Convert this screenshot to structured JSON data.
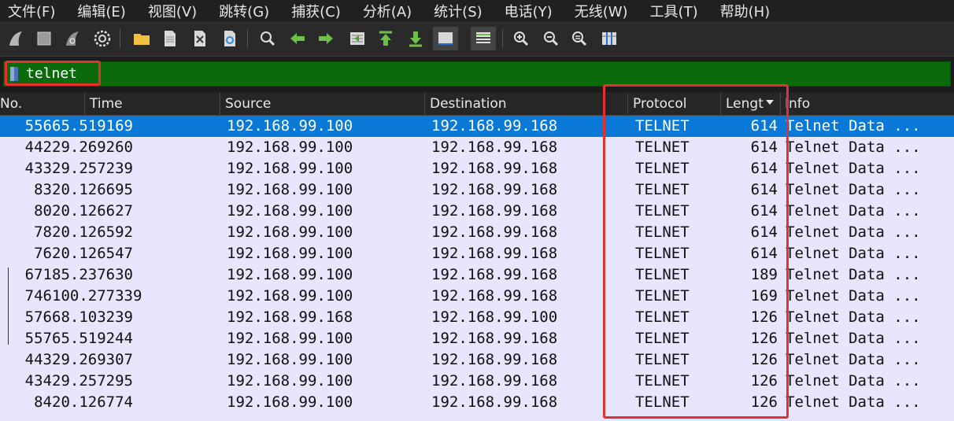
{
  "menu": [
    "文件(F)",
    "编辑(E)",
    "视图(V)",
    "跳转(G)",
    "捕获(C)",
    "分析(A)",
    "统计(S)",
    "电话(Y)",
    "无线(W)",
    "工具(T)",
    "帮助(H)"
  ],
  "toolbar": {
    "icons": [
      "shark-fin-start-icon",
      "stop-icon",
      "shark-fin-restart-icon",
      "options-gear-icon",
      "open-folder-icon",
      "file-icon",
      "close-file-icon",
      "reload-icon",
      "find-icon",
      "back-arrow-icon",
      "forward-arrow-icon",
      "go-to-packet-icon",
      "first-packet-icon",
      "last-packet-icon",
      "autoscroll-icon",
      "colorize-icon",
      "zoom-in-icon",
      "zoom-out-icon",
      "zoom-normal-icon",
      "resize-columns-icon"
    ]
  },
  "filter": {
    "value": "telnet"
  },
  "columns": {
    "no": "No.",
    "time": "Time",
    "source": "Source",
    "destination": "Destination",
    "protocol": "Protocol",
    "length": "Lengt",
    "info": "Info"
  },
  "packets": [
    {
      "no": "556",
      "time": "65.519169",
      "src": "192.168.99.100",
      "dst": "192.168.99.168",
      "proto": "TELNET",
      "len": "614",
      "info": "Telnet Data ..."
    },
    {
      "no": "442",
      "time": "29.269260",
      "src": "192.168.99.100",
      "dst": "192.168.99.168",
      "proto": "TELNET",
      "len": "614",
      "info": "Telnet Data ..."
    },
    {
      "no": "433",
      "time": "29.257239",
      "src": "192.168.99.100",
      "dst": "192.168.99.168",
      "proto": "TELNET",
      "len": "614",
      "info": "Telnet Data ..."
    },
    {
      "no": "83",
      "time": "20.126695",
      "src": "192.168.99.100",
      "dst": "192.168.99.168",
      "proto": "TELNET",
      "len": "614",
      "info": "Telnet Data ..."
    },
    {
      "no": "80",
      "time": "20.126627",
      "src": "192.168.99.100",
      "dst": "192.168.99.168",
      "proto": "TELNET",
      "len": "614",
      "info": "Telnet Data ..."
    },
    {
      "no": "78",
      "time": "20.126592",
      "src": "192.168.99.100",
      "dst": "192.168.99.168",
      "proto": "TELNET",
      "len": "614",
      "info": "Telnet Data ..."
    },
    {
      "no": "76",
      "time": "20.126547",
      "src": "192.168.99.100",
      "dst": "192.168.99.168",
      "proto": "TELNET",
      "len": "614",
      "info": "Telnet Data ..."
    },
    {
      "no": "671",
      "time": "85.237630",
      "src": "192.168.99.100",
      "dst": "192.168.99.168",
      "proto": "TELNET",
      "len": "189",
      "info": "Telnet Data ..."
    },
    {
      "no": "746",
      "time": "100.277339",
      "src": "192.168.99.100",
      "dst": "192.168.99.168",
      "proto": "TELNET",
      "len": "169",
      "info": "Telnet Data ..."
    },
    {
      "no": "576",
      "time": "68.103239",
      "src": "192.168.99.168",
      "dst": "192.168.99.100",
      "proto": "TELNET",
      "len": "126",
      "info": "Telnet Data ..."
    },
    {
      "no": "557",
      "time": "65.519244",
      "src": "192.168.99.100",
      "dst": "192.168.99.168",
      "proto": "TELNET",
      "len": "126",
      "info": "Telnet Data ..."
    },
    {
      "no": "443",
      "time": "29.269307",
      "src": "192.168.99.100",
      "dst": "192.168.99.168",
      "proto": "TELNET",
      "len": "126",
      "info": "Telnet Data ..."
    },
    {
      "no": "434",
      "time": "29.257295",
      "src": "192.168.99.100",
      "dst": "192.168.99.168",
      "proto": "TELNET",
      "len": "126",
      "info": "Telnet Data ..."
    },
    {
      "no": "84",
      "time": "20.126774",
      "src": "192.168.99.100",
      "dst": "192.168.99.168",
      "proto": "TELNET",
      "len": "126",
      "info": "Telnet Data ..."
    }
  ],
  "colors": {
    "filter_valid": "#0b6b0b",
    "selected_row": "#0a78d6",
    "row_bg": "#e7e6fe",
    "annotation": "#e53030"
  }
}
